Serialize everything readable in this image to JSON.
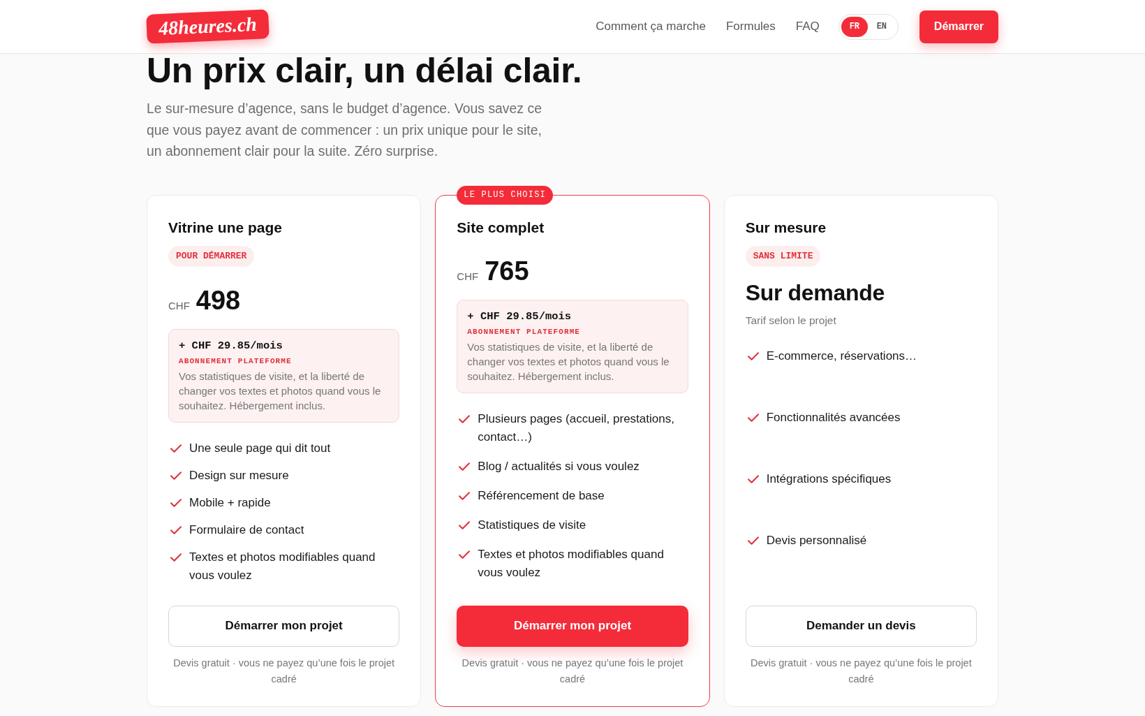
{
  "header": {
    "logo": "48heures.ch",
    "nav": [
      "Comment ça marche",
      "Formules",
      "FAQ"
    ],
    "languages": [
      {
        "label": "FR",
        "selected": true
      },
      {
        "label": "EN",
        "selected": false
      }
    ],
    "cta": "Démarrer"
  },
  "hero": {
    "title": "Un prix clair, un délai clair.",
    "subtitle": "Le sur-mesure d’agence, sans le budget d’agence. Vous savez ce que vous payez avant de commencer : un prix unique pour le site, un abonnement clair pour la suite. Zéro surprise."
  },
  "plans": [
    {
      "kind": "priced",
      "name": "Vitrine une page",
      "tag": "POUR DÉMARRER",
      "featured": false,
      "currency": "CHF",
      "price": "498",
      "subscription": {
        "price": "+ CHF 29.85/mois",
        "label": "ABONNEMENT PLATEFORME",
        "description": "Vos statistiques de visite, et la liberté de changer vos textes et photos quand vous le souhaitez. Hébergement inclus."
      },
      "features": [
        "Une seule page qui dit tout",
        "Design sur mesure",
        "Mobile + rapide",
        "Formulaire de contact",
        "Textes et photos modifiables quand vous voulez"
      ],
      "button": "Démarrer mon projet",
      "note": "Devis gratuit · vous ne payez qu’une fois le projet cadré"
    },
    {
      "kind": "priced",
      "name": "Site complet",
      "ribbon": "LE PLUS CHOISI",
      "featured": true,
      "currency": "CHF",
      "price": "765",
      "subscription": {
        "price": "+ CHF 29.85/mois",
        "label": "ABONNEMENT PLATEFORME",
        "description": "Vos statistiques de visite, et la liberté de changer vos textes et photos quand vous le souhaitez. Hébergement inclus."
      },
      "features": [
        "Plusieurs pages (accueil, prestations, contact…)",
        "Blog / actualités si vous voulez",
        "Référencement de base",
        "Statistiques de visite",
        "Textes et photos modifiables quand vous voulez"
      ],
      "button": "Démarrer mon projet",
      "note": "Devis gratuit · vous ne payez qu’une fois le projet cadré"
    },
    {
      "kind": "quote",
      "name": "Sur mesure",
      "tag": "SANS LIMITE",
      "featured": false,
      "price": "Sur demande",
      "price_note": "Tarif selon le projet",
      "features": [
        "E-commerce, réservations…",
        "Fonctionnalités avancées",
        "Intégrations spécifiques",
        "Devis personnalisé"
      ],
      "button": "Demander un devis",
      "note": "Devis gratuit · vous ne payez qu’une fois le projet cadré"
    }
  ]
}
